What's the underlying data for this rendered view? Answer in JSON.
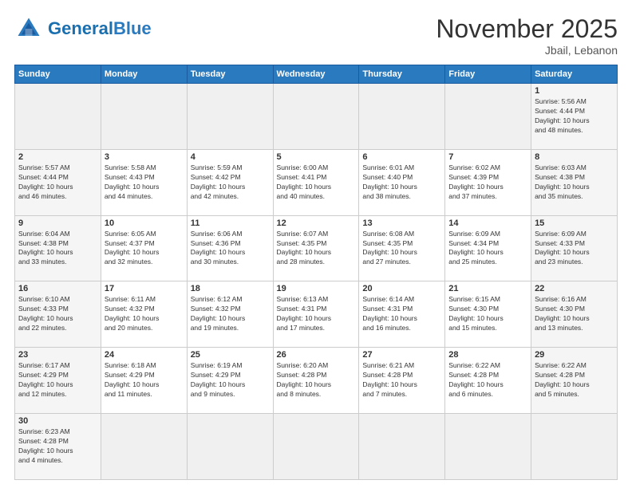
{
  "header": {
    "logo_general": "General",
    "logo_blue": "Blue",
    "month_title": "November 2025",
    "location": "Jbail, Lebanon"
  },
  "weekdays": [
    "Sunday",
    "Monday",
    "Tuesday",
    "Wednesday",
    "Thursday",
    "Friday",
    "Saturday"
  ],
  "weeks": [
    [
      {
        "day": "",
        "info": ""
      },
      {
        "day": "",
        "info": ""
      },
      {
        "day": "",
        "info": ""
      },
      {
        "day": "",
        "info": ""
      },
      {
        "day": "",
        "info": ""
      },
      {
        "day": "",
        "info": ""
      },
      {
        "day": "1",
        "info": "Sunrise: 5:56 AM\nSunset: 4:44 PM\nDaylight: 10 hours\nand 48 minutes."
      }
    ],
    [
      {
        "day": "2",
        "info": "Sunrise: 5:57 AM\nSunset: 4:44 PM\nDaylight: 10 hours\nand 46 minutes."
      },
      {
        "day": "3",
        "info": "Sunrise: 5:58 AM\nSunset: 4:43 PM\nDaylight: 10 hours\nand 44 minutes."
      },
      {
        "day": "4",
        "info": "Sunrise: 5:59 AM\nSunset: 4:42 PM\nDaylight: 10 hours\nand 42 minutes."
      },
      {
        "day": "5",
        "info": "Sunrise: 6:00 AM\nSunset: 4:41 PM\nDaylight: 10 hours\nand 40 minutes."
      },
      {
        "day": "6",
        "info": "Sunrise: 6:01 AM\nSunset: 4:40 PM\nDaylight: 10 hours\nand 38 minutes."
      },
      {
        "day": "7",
        "info": "Sunrise: 6:02 AM\nSunset: 4:39 PM\nDaylight: 10 hours\nand 37 minutes."
      },
      {
        "day": "8",
        "info": "Sunrise: 6:03 AM\nSunset: 4:38 PM\nDaylight: 10 hours\nand 35 minutes."
      }
    ],
    [
      {
        "day": "9",
        "info": "Sunrise: 6:04 AM\nSunset: 4:38 PM\nDaylight: 10 hours\nand 33 minutes."
      },
      {
        "day": "10",
        "info": "Sunrise: 6:05 AM\nSunset: 4:37 PM\nDaylight: 10 hours\nand 32 minutes."
      },
      {
        "day": "11",
        "info": "Sunrise: 6:06 AM\nSunset: 4:36 PM\nDaylight: 10 hours\nand 30 minutes."
      },
      {
        "day": "12",
        "info": "Sunrise: 6:07 AM\nSunset: 4:35 PM\nDaylight: 10 hours\nand 28 minutes."
      },
      {
        "day": "13",
        "info": "Sunrise: 6:08 AM\nSunset: 4:35 PM\nDaylight: 10 hours\nand 27 minutes."
      },
      {
        "day": "14",
        "info": "Sunrise: 6:09 AM\nSunset: 4:34 PM\nDaylight: 10 hours\nand 25 minutes."
      },
      {
        "day": "15",
        "info": "Sunrise: 6:09 AM\nSunset: 4:33 PM\nDaylight: 10 hours\nand 23 minutes."
      }
    ],
    [
      {
        "day": "16",
        "info": "Sunrise: 6:10 AM\nSunset: 4:33 PM\nDaylight: 10 hours\nand 22 minutes."
      },
      {
        "day": "17",
        "info": "Sunrise: 6:11 AM\nSunset: 4:32 PM\nDaylight: 10 hours\nand 20 minutes."
      },
      {
        "day": "18",
        "info": "Sunrise: 6:12 AM\nSunset: 4:32 PM\nDaylight: 10 hours\nand 19 minutes."
      },
      {
        "day": "19",
        "info": "Sunrise: 6:13 AM\nSunset: 4:31 PM\nDaylight: 10 hours\nand 17 minutes."
      },
      {
        "day": "20",
        "info": "Sunrise: 6:14 AM\nSunset: 4:31 PM\nDaylight: 10 hours\nand 16 minutes."
      },
      {
        "day": "21",
        "info": "Sunrise: 6:15 AM\nSunset: 4:30 PM\nDaylight: 10 hours\nand 15 minutes."
      },
      {
        "day": "22",
        "info": "Sunrise: 6:16 AM\nSunset: 4:30 PM\nDaylight: 10 hours\nand 13 minutes."
      }
    ],
    [
      {
        "day": "23",
        "info": "Sunrise: 6:17 AM\nSunset: 4:29 PM\nDaylight: 10 hours\nand 12 minutes."
      },
      {
        "day": "24",
        "info": "Sunrise: 6:18 AM\nSunset: 4:29 PM\nDaylight: 10 hours\nand 11 minutes."
      },
      {
        "day": "25",
        "info": "Sunrise: 6:19 AM\nSunset: 4:29 PM\nDaylight: 10 hours\nand 9 minutes."
      },
      {
        "day": "26",
        "info": "Sunrise: 6:20 AM\nSunset: 4:28 PM\nDaylight: 10 hours\nand 8 minutes."
      },
      {
        "day": "27",
        "info": "Sunrise: 6:21 AM\nSunset: 4:28 PM\nDaylight: 10 hours\nand 7 minutes."
      },
      {
        "day": "28",
        "info": "Sunrise: 6:22 AM\nSunset: 4:28 PM\nDaylight: 10 hours\nand 6 minutes."
      },
      {
        "day": "29",
        "info": "Sunrise: 6:22 AM\nSunset: 4:28 PM\nDaylight: 10 hours\nand 5 minutes."
      }
    ],
    [
      {
        "day": "30",
        "info": "Sunrise: 6:23 AM\nSunset: 4:28 PM\nDaylight: 10 hours\nand 4 minutes."
      },
      {
        "day": "",
        "info": ""
      },
      {
        "day": "",
        "info": ""
      },
      {
        "day": "",
        "info": ""
      },
      {
        "day": "",
        "info": ""
      },
      {
        "day": "",
        "info": ""
      },
      {
        "day": "",
        "info": ""
      }
    ]
  ]
}
